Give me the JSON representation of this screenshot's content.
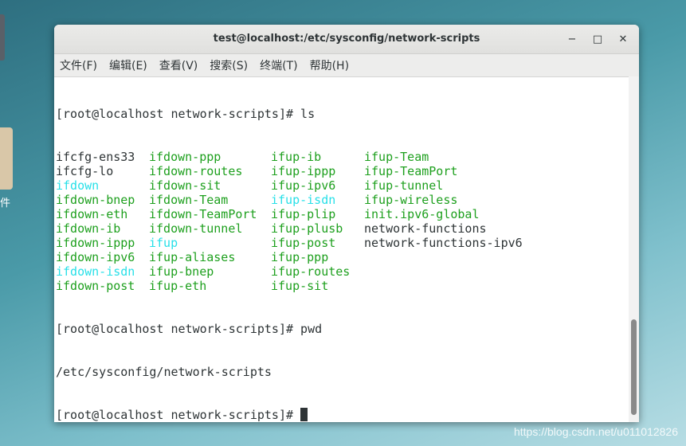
{
  "window": {
    "title": "test@localhost:/etc/sysconfig/network-scripts"
  },
  "controls": {
    "minimize": "−",
    "maximize": "□",
    "close": "✕"
  },
  "menu": [
    "文件(F)",
    "编辑(E)",
    "查看(V)",
    "搜索(S)",
    "终端(T)",
    "帮助(H)"
  ],
  "terminal": {
    "prompt1": "[root@localhost network-scripts]# ls",
    "ls_rows": [
      [
        [
          "ifcfg-ens33",
          "plain"
        ],
        [
          "ifdown-ppp",
          "green"
        ],
        [
          "ifup-ib",
          "green"
        ],
        [
          "ifup-Team",
          "green"
        ]
      ],
      [
        [
          "ifcfg-lo",
          "plain"
        ],
        [
          "ifdown-routes",
          "green"
        ],
        [
          "ifup-ippp",
          "green"
        ],
        [
          "ifup-TeamPort",
          "green"
        ]
      ],
      [
        [
          "ifdown",
          "cyan"
        ],
        [
          "ifdown-sit",
          "green"
        ],
        [
          "ifup-ipv6",
          "green"
        ],
        [
          "ifup-tunnel",
          "green"
        ]
      ],
      [
        [
          "ifdown-bnep",
          "green"
        ],
        [
          "ifdown-Team",
          "green"
        ],
        [
          "ifup-isdn",
          "cyan"
        ],
        [
          "ifup-wireless",
          "green"
        ]
      ],
      [
        [
          "ifdown-eth",
          "green"
        ],
        [
          "ifdown-TeamPort",
          "green"
        ],
        [
          "ifup-plip",
          "green"
        ],
        [
          "init.ipv6-global",
          "green"
        ]
      ],
      [
        [
          "ifdown-ib",
          "green"
        ],
        [
          "ifdown-tunnel",
          "green"
        ],
        [
          "ifup-plusb",
          "green"
        ],
        [
          "network-functions",
          "plain"
        ]
      ],
      [
        [
          "ifdown-ippp",
          "green"
        ],
        [
          "ifup",
          "cyan"
        ],
        [
          "ifup-post",
          "green"
        ],
        [
          "network-functions-ipv6",
          "plain"
        ]
      ],
      [
        [
          "ifdown-ipv6",
          "green"
        ],
        [
          "ifup-aliases",
          "green"
        ],
        [
          "ifup-ppp",
          "green"
        ],
        [
          "",
          ""
        ]
      ],
      [
        [
          "ifdown-isdn",
          "cyan"
        ],
        [
          "ifup-bnep",
          "green"
        ],
        [
          "ifup-routes",
          "green"
        ],
        [
          "",
          ""
        ]
      ],
      [
        [
          "ifdown-post",
          "green"
        ],
        [
          "ifup-eth",
          "green"
        ],
        [
          "ifup-sit",
          "green"
        ],
        [
          "",
          ""
        ]
      ]
    ],
    "prompt2": "[root@localhost network-scripts]# pwd",
    "output_pwd": "/etc/sysconfig/network-scripts",
    "prompt3": "[root@localhost network-scripts]# "
  },
  "watermark": "https://blog.csdn.net/u011012826",
  "desktop": {
    "glyph": "件"
  }
}
